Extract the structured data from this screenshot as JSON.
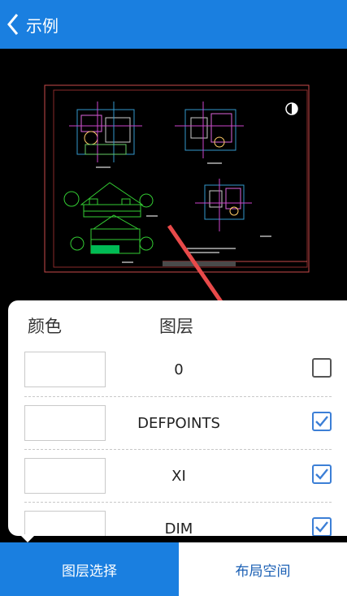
{
  "header": {
    "title": "示例",
    "back_icon": "chevron-left-icon"
  },
  "layer_panel": {
    "color_header": "颜色",
    "layer_header": "图层",
    "rows": [
      {
        "name": "0",
        "checked": false
      },
      {
        "name": "DEFPOINTS",
        "checked": true
      },
      {
        "name": "XI",
        "checked": true
      },
      {
        "name": "DIM",
        "checked": true
      }
    ]
  },
  "tabs": [
    {
      "label": "图层选择",
      "active": true
    },
    {
      "label": "布局空间",
      "active": false
    }
  ],
  "colors": {
    "primary": "#1a7fe0",
    "checkbox_checked": "#3c7fd6",
    "arrow": "#e84a4a"
  }
}
